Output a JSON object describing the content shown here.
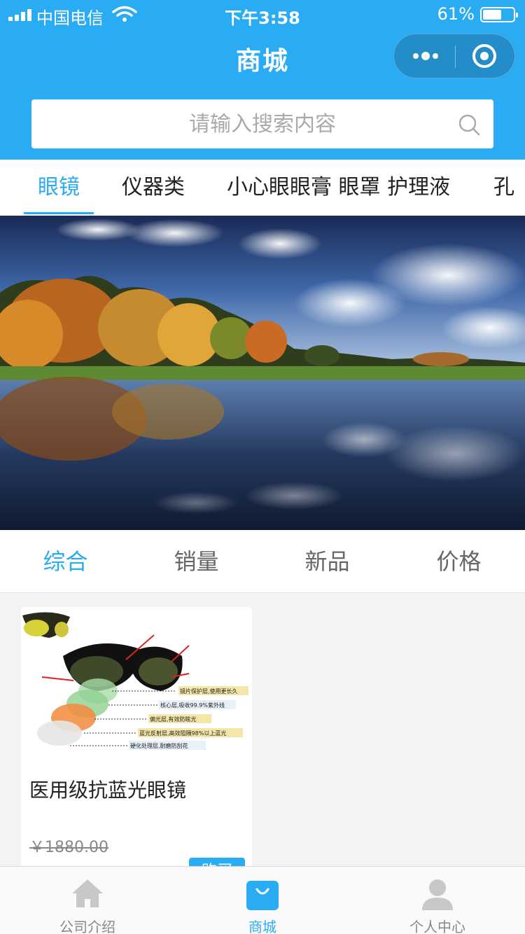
{
  "status_bar": {
    "carrier": "中国电信",
    "time": "下午3:58",
    "battery": "61%",
    "battery_level": 0.61
  },
  "nav": {
    "title": "商城"
  },
  "search": {
    "placeholder": "请输入搜索内容",
    "value": ""
  },
  "categories": [
    {
      "label": "眼镜",
      "active": true
    },
    {
      "label": "仪器类",
      "active": false
    },
    {
      "label": "小心眼眼膏 眼罩 护理液",
      "active": false
    },
    {
      "label": "孔",
      "active": false
    }
  ],
  "sort_options": [
    {
      "label": "综合",
      "active": true
    },
    {
      "label": "销量",
      "active": false
    },
    {
      "label": "新品",
      "active": false
    },
    {
      "label": "价格",
      "active": false
    }
  ],
  "products": [
    {
      "name": "医用级抗蓝光眼镜",
      "original_price": "￥1880.00",
      "price": "￥1880.00",
      "buy_label": "购买",
      "image_labels": [
        "镜片保护层,使用更长久",
        "核心层,吸收99.9%紫外线",
        "偏光层,有效防眩光",
        "蓝光反射层,高效阻隔98%以上蓝光",
        "硬化处理层,耐磨防刮花"
      ]
    }
  ],
  "tabbar": [
    {
      "label": "公司介绍",
      "icon": "home-icon",
      "active": false
    },
    {
      "label": "商城",
      "icon": "shopping-bag-icon",
      "active": true
    },
    {
      "label": "个人中心",
      "icon": "user-icon",
      "active": false
    }
  ],
  "colors": {
    "primary": "#2aacf5",
    "price": "#e4393c",
    "inactive": "#888888"
  }
}
